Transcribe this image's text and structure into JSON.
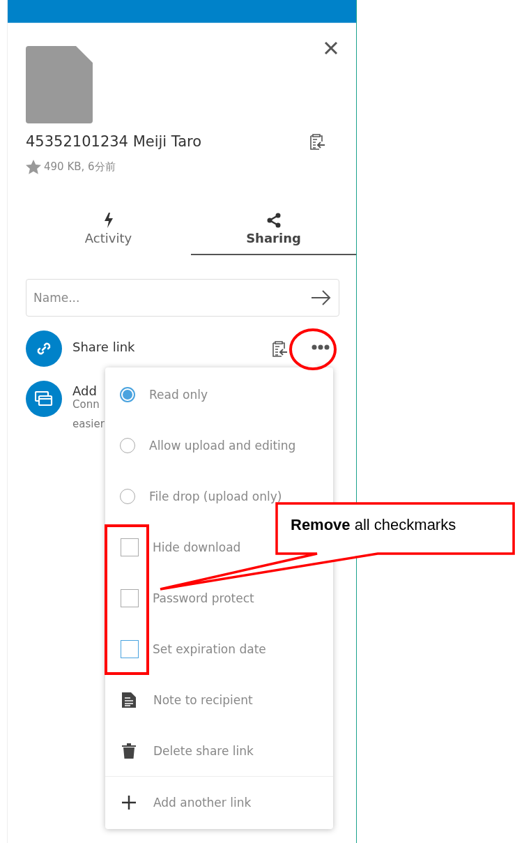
{
  "header": {
    "file_name": "45352101234 Meiji Taro",
    "meta": "490 KB, 6分前"
  },
  "tabs": [
    {
      "label": "Activity",
      "selected": false
    },
    {
      "label": "Sharing",
      "selected": true
    }
  ],
  "share_input": {
    "placeholder": "Name..."
  },
  "shares": [
    {
      "kind": "link",
      "title": "Share link"
    },
    {
      "kind": "app",
      "title": "Add",
      "subtitle": "Conn",
      "note": "easier"
    }
  ],
  "menu": {
    "items": [
      {
        "kind": "radio",
        "label": "Read only",
        "selected": true
      },
      {
        "kind": "radio",
        "label": "Allow upload and editing",
        "selected": false
      },
      {
        "kind": "radio",
        "label": "File drop (upload only)",
        "selected": false
      },
      {
        "kind": "checkbox",
        "label": "Hide download",
        "checked": false,
        "color": "#aaaaaa"
      },
      {
        "kind": "checkbox",
        "label": "Password protect",
        "checked": false,
        "color": "#aaaaaa"
      },
      {
        "kind": "checkbox",
        "label": "Set expiration date",
        "checked": false,
        "color": "#4aa3df"
      },
      {
        "kind": "note",
        "label": "Note to recipient"
      },
      {
        "kind": "delete",
        "label": "Delete share link"
      },
      {
        "kind": "separator"
      },
      {
        "kind": "add",
        "label": "Add another link"
      }
    ]
  },
  "callout": {
    "text": "**Remove** all checkmarks"
  }
}
